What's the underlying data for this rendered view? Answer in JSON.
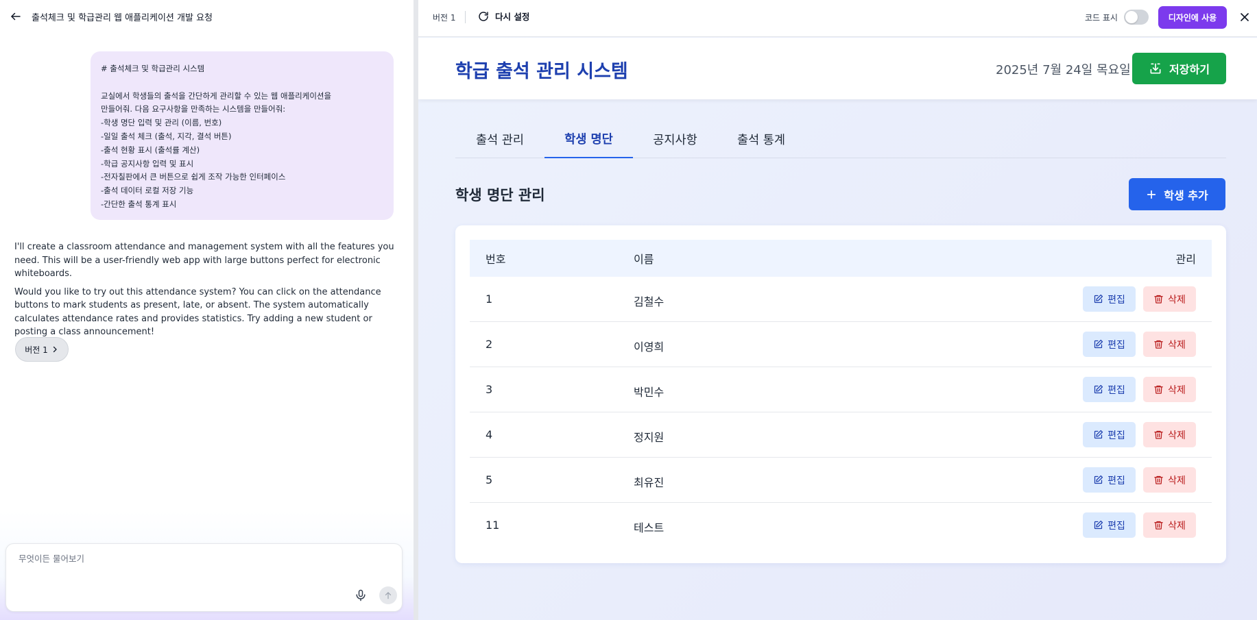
{
  "chat": {
    "title": "출석체크 및 학급관리 웹 애플리케이션 개발 요청",
    "user_message_lines": [
      "# 출석체크 및 학급관리 시스템",
      "",
      "교실에서 학생들의 출석을 간단하게 관리할 수 있는 웹 애플리케이션을",
      "만들어줘. 다음 요구사항을 만족하는 시스템을 만들어줘:",
      "-학생 명단 입력 및 관리 (이름, 번호)",
      "-일일 출석 체크 (출석, 지각, 결석 버튼)",
      "-출석 현황 표시 (출석률 계산)",
      "-학급 공지사항 입력 및 표시",
      "-전자칠판에서 큰 버튼으로 쉽게 조작 가능한 인터페이스",
      "-출석 데이터 로컬 저장 기능",
      "-간단한 출석 통계 표시"
    ],
    "assistant_paragraphs": [
      "I'll create a classroom attendance and management system with all the features you need. This will be a user-friendly web app with large buttons perfect for electronic whiteboards.",
      "Would you like to try out this attendance system? You can click on the attendance buttons to mark students as present, late, or absent. The system automatically calculates attendance rates and provides statistics. Try adding a new student or posting a class announcement!"
    ],
    "version_chip": "버전 1",
    "input_placeholder": "무엇이든 물어보기"
  },
  "toolbar": {
    "version": "버전 1",
    "reset_label": "다시 설정",
    "code_toggle_label": "코드 표시",
    "code_toggle_on": false,
    "use_design_label": "디자인에 사용"
  },
  "app": {
    "title": "학급 출석 관리 시스템",
    "date": "2025년 7월 24일 목요일",
    "save_label": "저장하기",
    "tabs": [
      {
        "label": "출석 관리",
        "active": false
      },
      {
        "label": "학생 명단",
        "active": true
      },
      {
        "label": "공지사항",
        "active": false
      },
      {
        "label": "출석 통계",
        "active": false
      }
    ],
    "section_title": "학생 명단 관리",
    "add_student_label": "학생 추가",
    "table": {
      "headers": {
        "no": "번호",
        "name": "이름",
        "manage": "관리"
      },
      "rows": [
        {
          "no": "1",
          "name": "김철수"
        },
        {
          "no": "2",
          "name": "이영희"
        },
        {
          "no": "3",
          "name": "박민수"
        },
        {
          "no": "4",
          "name": "정지원"
        },
        {
          "no": "5",
          "name": "최유진"
        },
        {
          "no": "11",
          "name": "테스트"
        }
      ],
      "edit_label": "편집",
      "delete_label": "삭제"
    }
  },
  "colors": {
    "primary": "#2563eb",
    "title_blue": "#1e40af",
    "save_green": "#16a34a",
    "use_design_purple": "#7c3aed",
    "edit_bg": "#dbeafe",
    "delete_bg": "#fee2e2"
  },
  "icons": {
    "back": "arrow-left-icon",
    "reset": "refresh-icon",
    "close": "close-icon",
    "save": "download-icon",
    "add": "plus-icon",
    "edit": "pencil-square-icon",
    "delete": "trash-icon",
    "mic": "microphone-icon",
    "send": "arrow-up-icon",
    "chevron": "chevron-right-icon"
  }
}
